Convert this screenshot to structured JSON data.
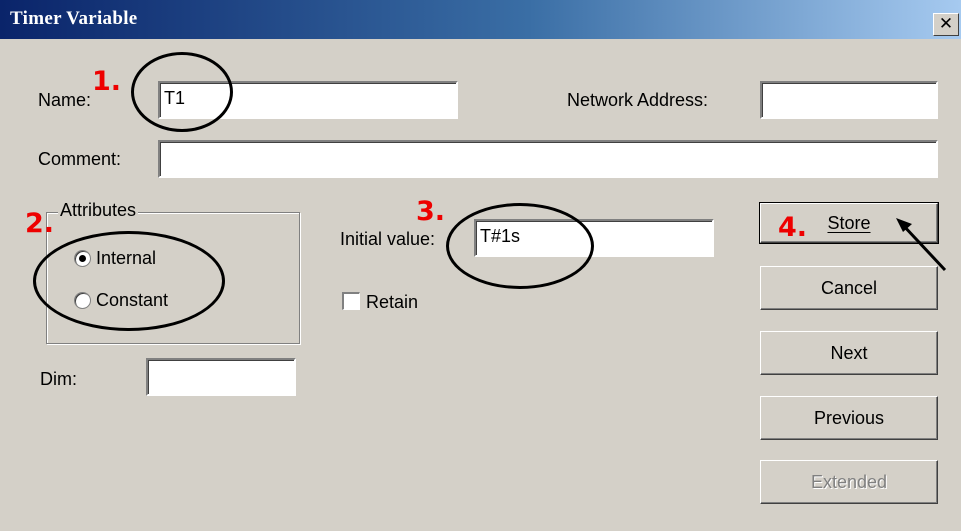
{
  "window": {
    "title": "Timer Variable",
    "close_icon": "close-icon"
  },
  "fields": {
    "name_label": "Name:",
    "name_value": "T1",
    "network_label": "Network Address:",
    "network_value": "",
    "comment_label": "Comment:",
    "comment_value": "",
    "initial_label": "Initial value:",
    "initial_value": "T#1s",
    "dim_label": "Dim:",
    "dim_value": ""
  },
  "attributes": {
    "title": "Attributes",
    "options": [
      {
        "label": "Internal",
        "selected": true
      },
      {
        "label": "Constant",
        "selected": false
      }
    ]
  },
  "retain": {
    "label": "Retain",
    "checked": false
  },
  "buttons": {
    "store": "Store",
    "cancel": "Cancel",
    "next": "Next",
    "previous": "Previous",
    "extended": "Extended"
  },
  "annotations": {
    "step1": "1.",
    "step2": "2.",
    "step3": "3.",
    "step4": "4.",
    "color": "#ee0000"
  }
}
